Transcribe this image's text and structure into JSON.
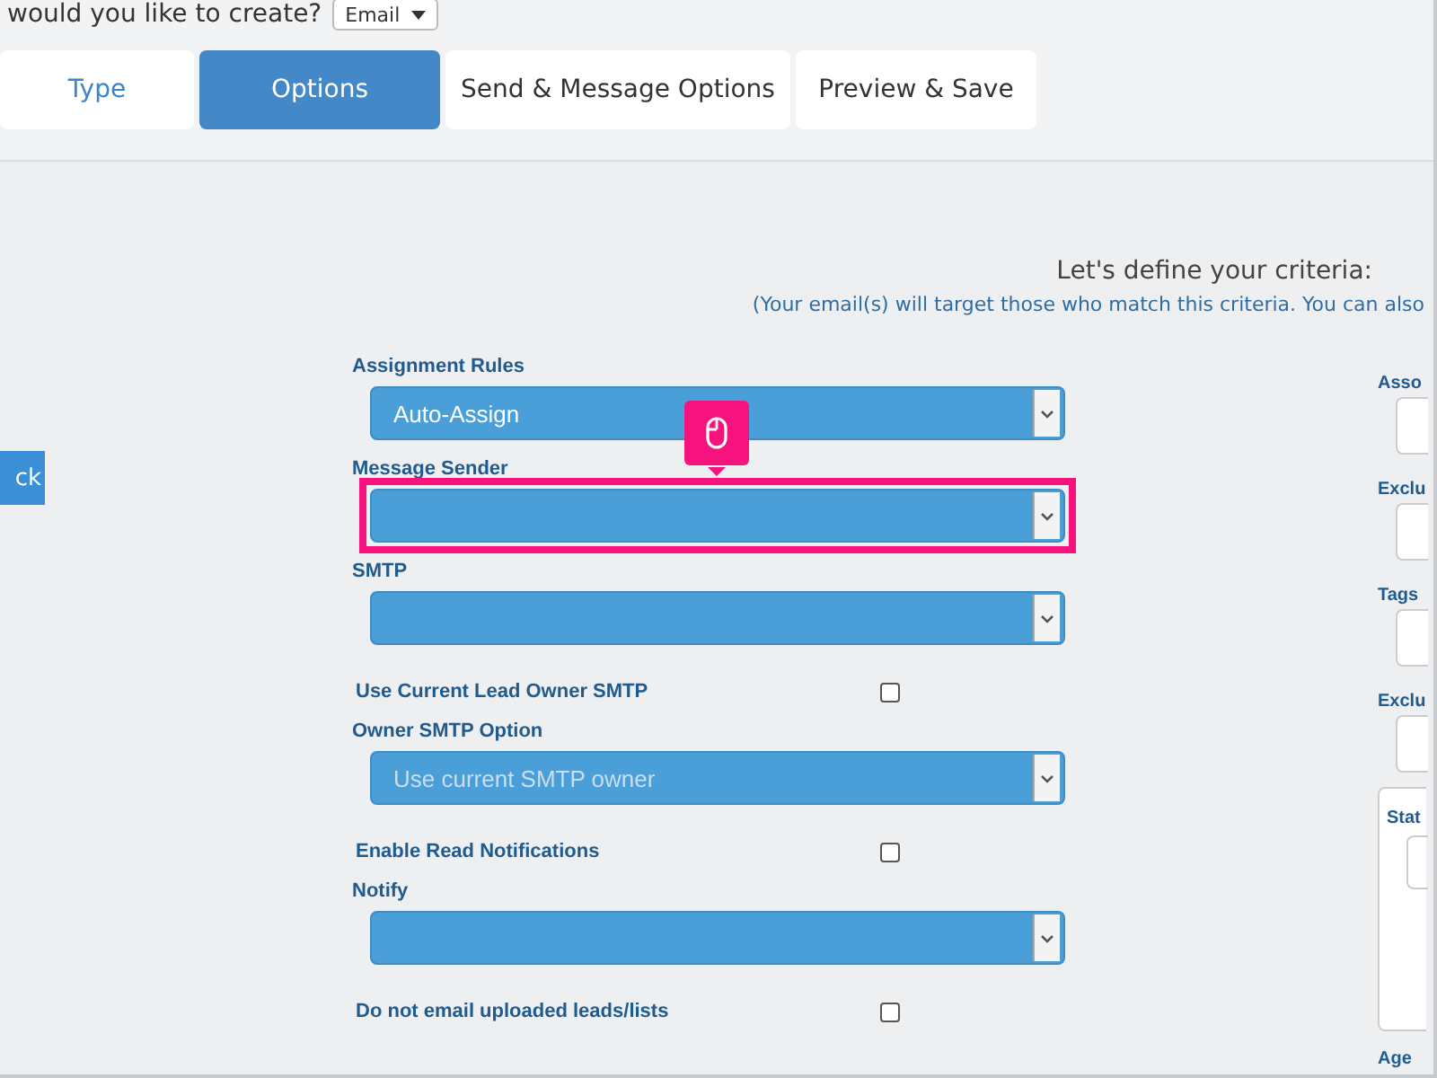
{
  "header": {
    "question": "would you like to create?",
    "type_select": {
      "value": "Email"
    }
  },
  "tabs": [
    {
      "label": "Type",
      "selected": false
    },
    {
      "label": "Options",
      "selected": true
    },
    {
      "label": "Send & Message Options",
      "selected": false
    },
    {
      "label": "Preview & Save",
      "selected": false
    }
  ],
  "back_button": {
    "label": "ck"
  },
  "criteria": {
    "title": "Let's define your criteria:",
    "subtitle": "(Your email(s) will target those who match this criteria. You can also"
  },
  "fields": [
    {
      "kind": "select",
      "label": "Assignment Rules",
      "value": "Auto-Assign",
      "highlighted": false
    },
    {
      "kind": "select",
      "label": "Message Sender",
      "highlighted": true
    },
    {
      "kind": "select",
      "label": "SMTP",
      "highlighted": false
    },
    {
      "kind": "checkbox",
      "label": "Use Current Lead Owner SMTP",
      "checked": false
    },
    {
      "kind": "select",
      "label": "Owner SMTP Option",
      "placeholder": "Use current SMTP owner",
      "highlighted": false
    },
    {
      "kind": "checkbox",
      "label": "Enable Read Notifications",
      "checked": false
    },
    {
      "kind": "select",
      "label": "Notify",
      "highlighted": false
    },
    {
      "kind": "checkbox",
      "label": "Do not email uploaded leads/lists",
      "checked": false
    }
  ],
  "right_fields": [
    {
      "kind": "input",
      "label": "Asso"
    },
    {
      "kind": "input",
      "label": "Exclu"
    },
    {
      "kind": "input",
      "label": "Tags"
    },
    {
      "kind": "input",
      "label": "Exclu"
    },
    {
      "kind": "panel",
      "label": "Stat"
    },
    {
      "kind": "label",
      "label": "Age"
    }
  ]
}
